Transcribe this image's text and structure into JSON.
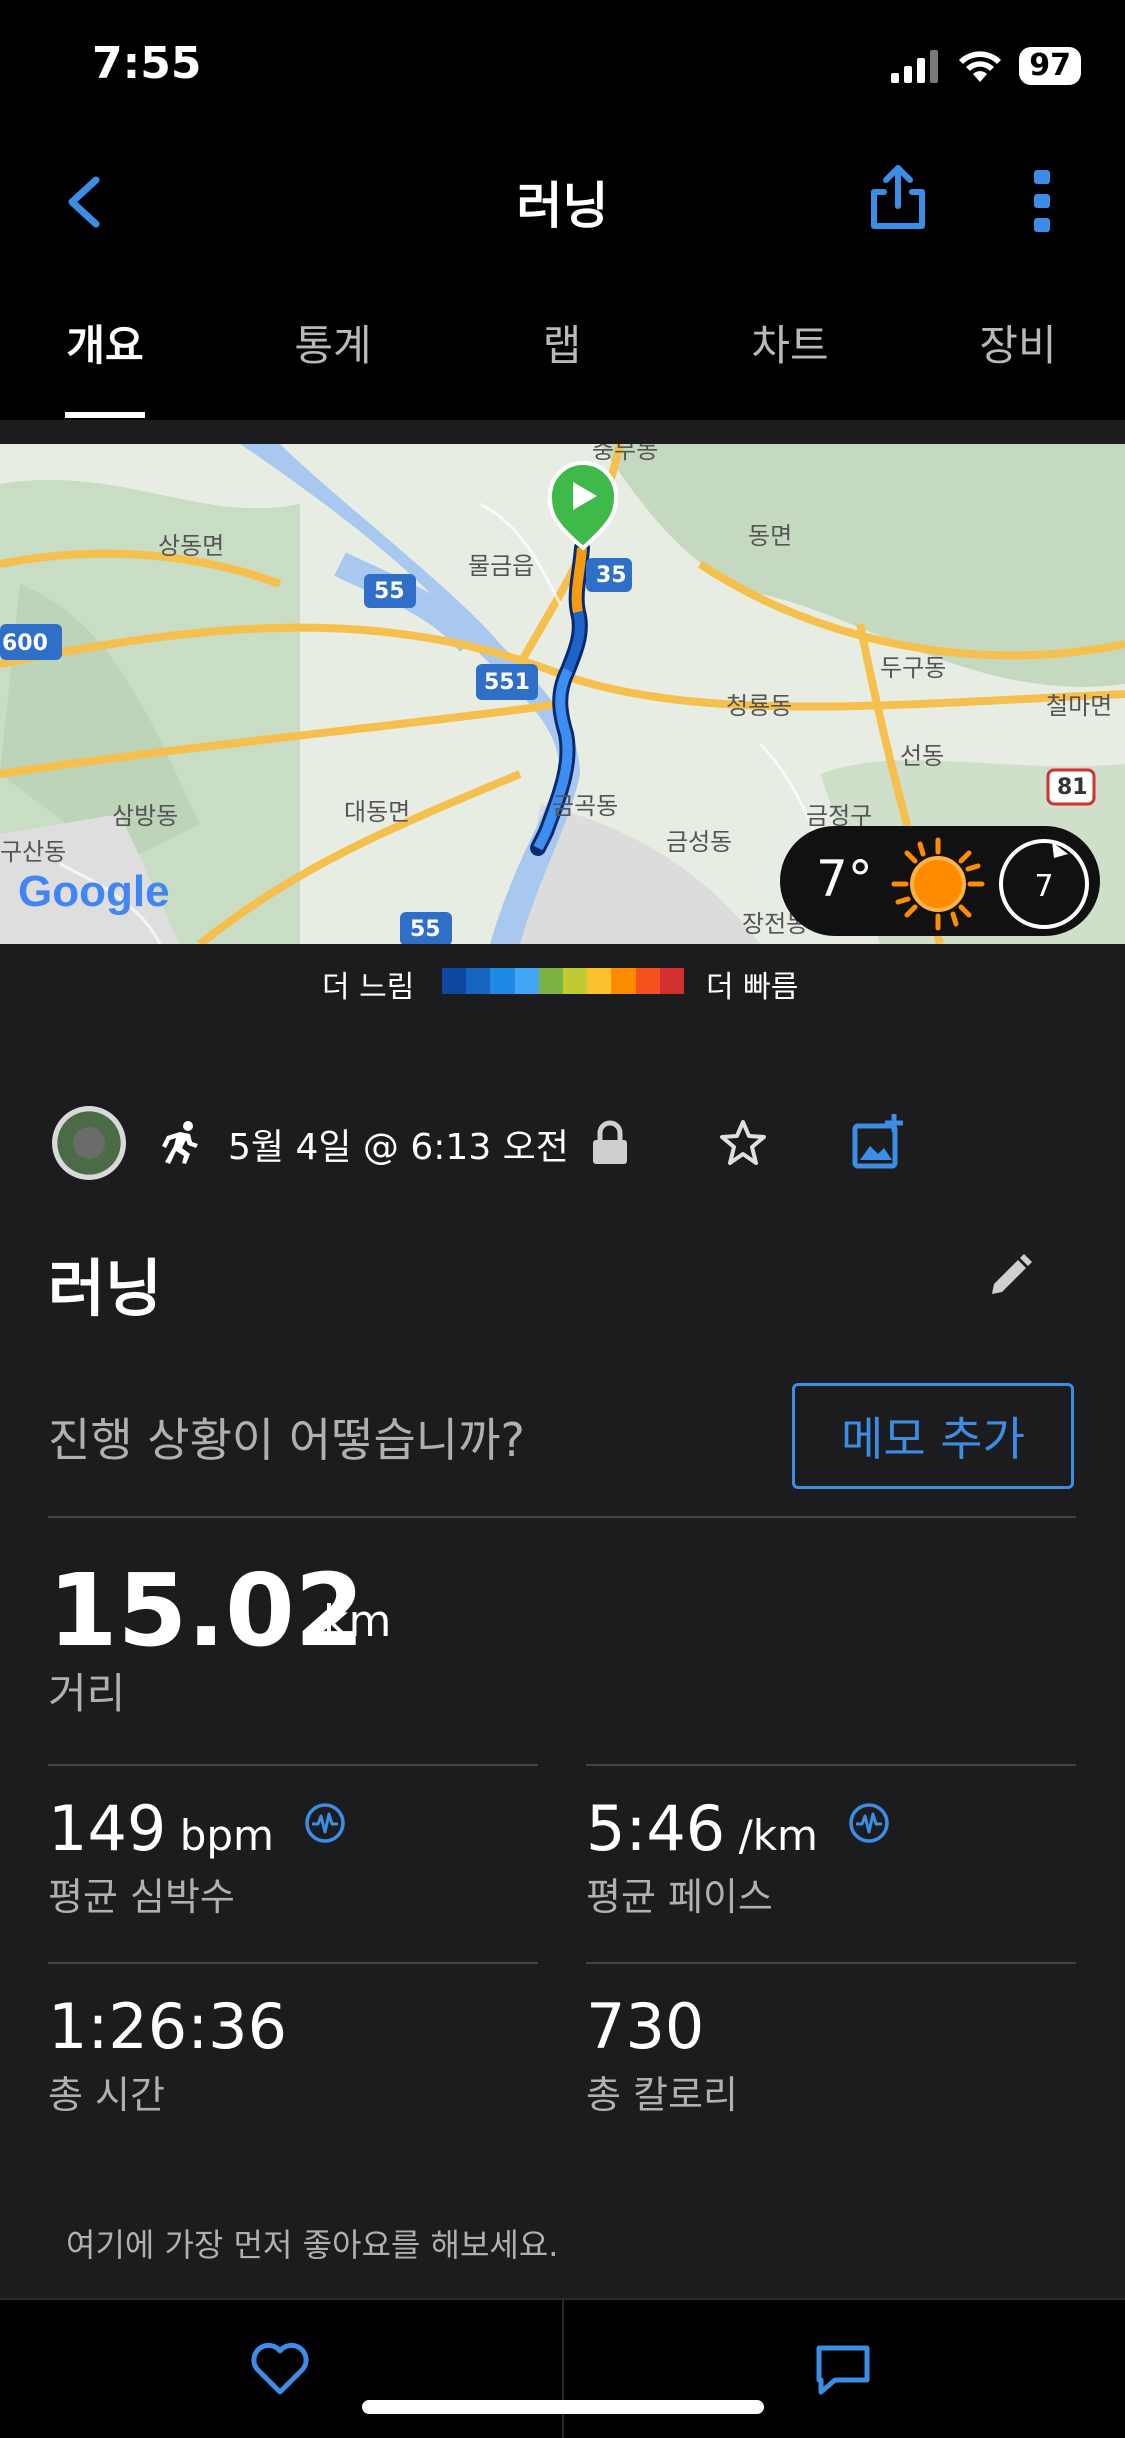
{
  "status": {
    "time": "7:55",
    "battery": "97"
  },
  "nav": {
    "title": "러닝"
  },
  "tabs": [
    {
      "label": "개요",
      "active": true
    },
    {
      "label": "통계",
      "active": false
    },
    {
      "label": "랩",
      "active": false
    },
    {
      "label": "차트",
      "active": false
    },
    {
      "label": "장비",
      "active": false
    }
  ],
  "map": {
    "places": [
      "상동면",
      "물금읍",
      "동면",
      "두구동",
      "청룡동",
      "철마면",
      "선동",
      "삼방동",
      "대동면",
      "금곡동",
      "금성동",
      "금정구",
      "구산동",
      "장전동",
      "충무동"
    ],
    "routes": [
      "55",
      "35",
      "551",
      "600",
      "81",
      "55"
    ],
    "logo": "Google"
  },
  "weather": {
    "temp": "7°",
    "wind": "7"
  },
  "legend": {
    "slow": "더 느림",
    "fast": "더 빠름",
    "colors": [
      "#0d47a1",
      "#1565c0",
      "#1e88e5",
      "#42a5f5",
      "#7cb342",
      "#c0ca33",
      "#fbc02d",
      "#fb8c00",
      "#f4511e",
      "#d32f2f"
    ]
  },
  "meta": {
    "date": "5월 4일 @ 6:13 오전"
  },
  "activity": {
    "title": "러닝"
  },
  "notes": {
    "prompt": "진행 상황이 어떻습니까?",
    "add_memo": "메모 추가"
  },
  "distance": {
    "value": "15.02",
    "unit": "km",
    "label": "거리"
  },
  "stats": {
    "heart_rate": {
      "value": "149",
      "unit": " bpm",
      "label": "평균 심박수"
    },
    "pace": {
      "value": "5:46",
      "unit": " /km",
      "label": "평균 페이스"
    },
    "time": {
      "value": "1:26:36",
      "label": "총 시간"
    },
    "calories": {
      "value": "730",
      "label": "총 칼로리"
    }
  },
  "social": {
    "like_prompt": "여기에 가장 먼저 좋아요를 해보세요."
  },
  "colors": {
    "accent": "#3c8de6",
    "start_pin": "#3fb94a",
    "sun": "#ff8c00"
  }
}
